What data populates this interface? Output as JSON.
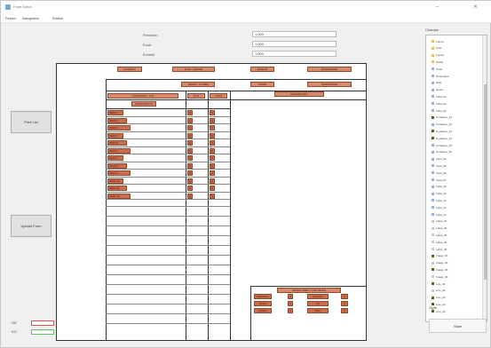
{
  "window": {
    "title": "Form Editor",
    "minimize": "–",
    "close": "×"
  },
  "menu": [
    "Fichier",
    "Navigation",
    "Édition"
  ],
  "fields": [
    {
      "label": "Précision",
      "value": "1.000"
    },
    {
      "label": "Ecart",
      "value": "1.000"
    },
    {
      "label": "Échelle",
      "value": "1.000"
    }
  ],
  "left_buttons": {
    "print": "Print List",
    "upload": "Upload Form"
  },
  "form": {
    "header_tags": [
      "NUMERO",
      "DATE / HEURE",
      "MIXEUR",
      "OPERATEUR"
    ],
    "header_tags_row2": [
      "TEMPS / DUREE",
      "POIDS",
      "OPERATEUR"
    ],
    "table_header": [
      "CAMPAGNE / LOT",
      "QTE",
      "UNITE"
    ],
    "section_label": "INGREDIENTS",
    "comment_label": "REMARQUES",
    "rows": [
      [
        "INGR 1",
        "Q",
        "U"
      ],
      [
        "INGR 2",
        "Q",
        "U"
      ],
      [
        "INGR 3",
        "Q",
        "U"
      ],
      [
        "INGR 4",
        "Q",
        "U"
      ],
      [
        "INGR 5",
        "Q",
        "U"
      ],
      [
        "INGR 6",
        "Q",
        "U"
      ],
      [
        "INGR 7",
        "Q",
        "U"
      ],
      [
        "INGR 8",
        "Q",
        "U"
      ],
      [
        "INGR 9",
        "Q",
        "U"
      ],
      [
        "INGR 10",
        "Q",
        "U"
      ],
      [
        "INGR 11",
        "Q",
        "U"
      ],
      [
        "INGR 12",
        "Q",
        "U"
      ]
    ],
    "footer_title": "SIGNATURES / CONTROLE",
    "footer_tags": [
      [
        "Opérateur",
        "N",
        "Contrôle",
        "V"
      ],
      [
        "Début",
        "N",
        "Fin",
        "V"
      ],
      [
        "Qualité",
        "N",
        "Date",
        "V"
      ]
    ]
  },
  "panel": {
    "title": "Champs",
    "items": [
      {
        "label": "Forms",
        "color": "#e8c25a"
      },
      {
        "label": "Liste",
        "color": "#e8c25a"
      },
      {
        "label": "Layout",
        "color": "#e8c25a"
      },
      {
        "label": "Fields",
        "color": "#e8c25a"
      },
      {
        "label": "Texte",
        "color": "#9ab0c8"
      },
      {
        "label": "Numérique",
        "color": "#9ab0c8"
      },
      {
        "label": "Date",
        "color": "#9ab0c8"
      },
      {
        "label": "Heure",
        "color": "#9ab0c8"
      },
      {
        "label": "Field_01",
        "color": "#9ab0c8"
      },
      {
        "label": "Field_02",
        "color": "#9ab0c8"
      },
      {
        "label": "Field_03",
        "color": "#9ab0c8"
      },
      {
        "label": "Container_01",
        "color": "#5a5a30"
      },
      {
        "label": "Container_02",
        "color": "#9ab0c8"
      },
      {
        "label": "Container_03",
        "color": "#5a5a30"
      },
      {
        "label": "Container_04",
        "color": "#5a5a30"
      },
      {
        "label": "Container_05",
        "color": "#9ab0c8"
      },
      {
        "label": "Container_06",
        "color": "#9ab0c8"
      },
      {
        "label": "Field_04",
        "color": "#9ab0c8"
      },
      {
        "label": "Field_05",
        "color": "#9ab0c8"
      },
      {
        "label": "Field_06",
        "color": "#9ab0c8"
      },
      {
        "label": "Field_07",
        "color": "#9ab0c8"
      },
      {
        "label": "Field_08",
        "color": "#9ab0c8"
      },
      {
        "label": "Field_09",
        "color": "#9ab0c8"
      },
      {
        "label": "Field_10",
        "color": "#9ab0c8"
      },
      {
        "label": "Field_11",
        "color": "#9ab0c8"
      },
      {
        "label": "Field_12",
        "color": "#9ab0c8"
      },
      {
        "label": "Label_01",
        "color": "#cccccc"
      },
      {
        "label": "Label_02",
        "color": "#cccccc"
      },
      {
        "label": "Label_03",
        "color": "#cccccc"
      },
      {
        "label": "Label_04",
        "color": "#cccccc"
      },
      {
        "label": "Label_05",
        "color": "#cccccc"
      },
      {
        "label": "Image_01",
        "color": "#5a5a30"
      },
      {
        "label": "Image_02",
        "color": "#cccccc"
      },
      {
        "label": "Image_03",
        "color": "#5a5a30"
      },
      {
        "label": "Image_04",
        "color": "#cccccc"
      },
      {
        "label": "Line_01",
        "color": "#5a5a30"
      },
      {
        "label": "Line_02",
        "color": "#cccccc"
      },
      {
        "label": "Line_03",
        "color": "#5a5a30"
      },
      {
        "label": "Line_04",
        "color": "#5a5a30"
      },
      {
        "label": "Line_05",
        "color": "#5a5a30"
      }
    ]
  },
  "panel_label": "Style",
  "save_button": "Save",
  "legend": [
    {
      "label": "OK",
      "color": "#e05050"
    },
    {
      "label": "KO",
      "color": "#60c060"
    }
  ]
}
